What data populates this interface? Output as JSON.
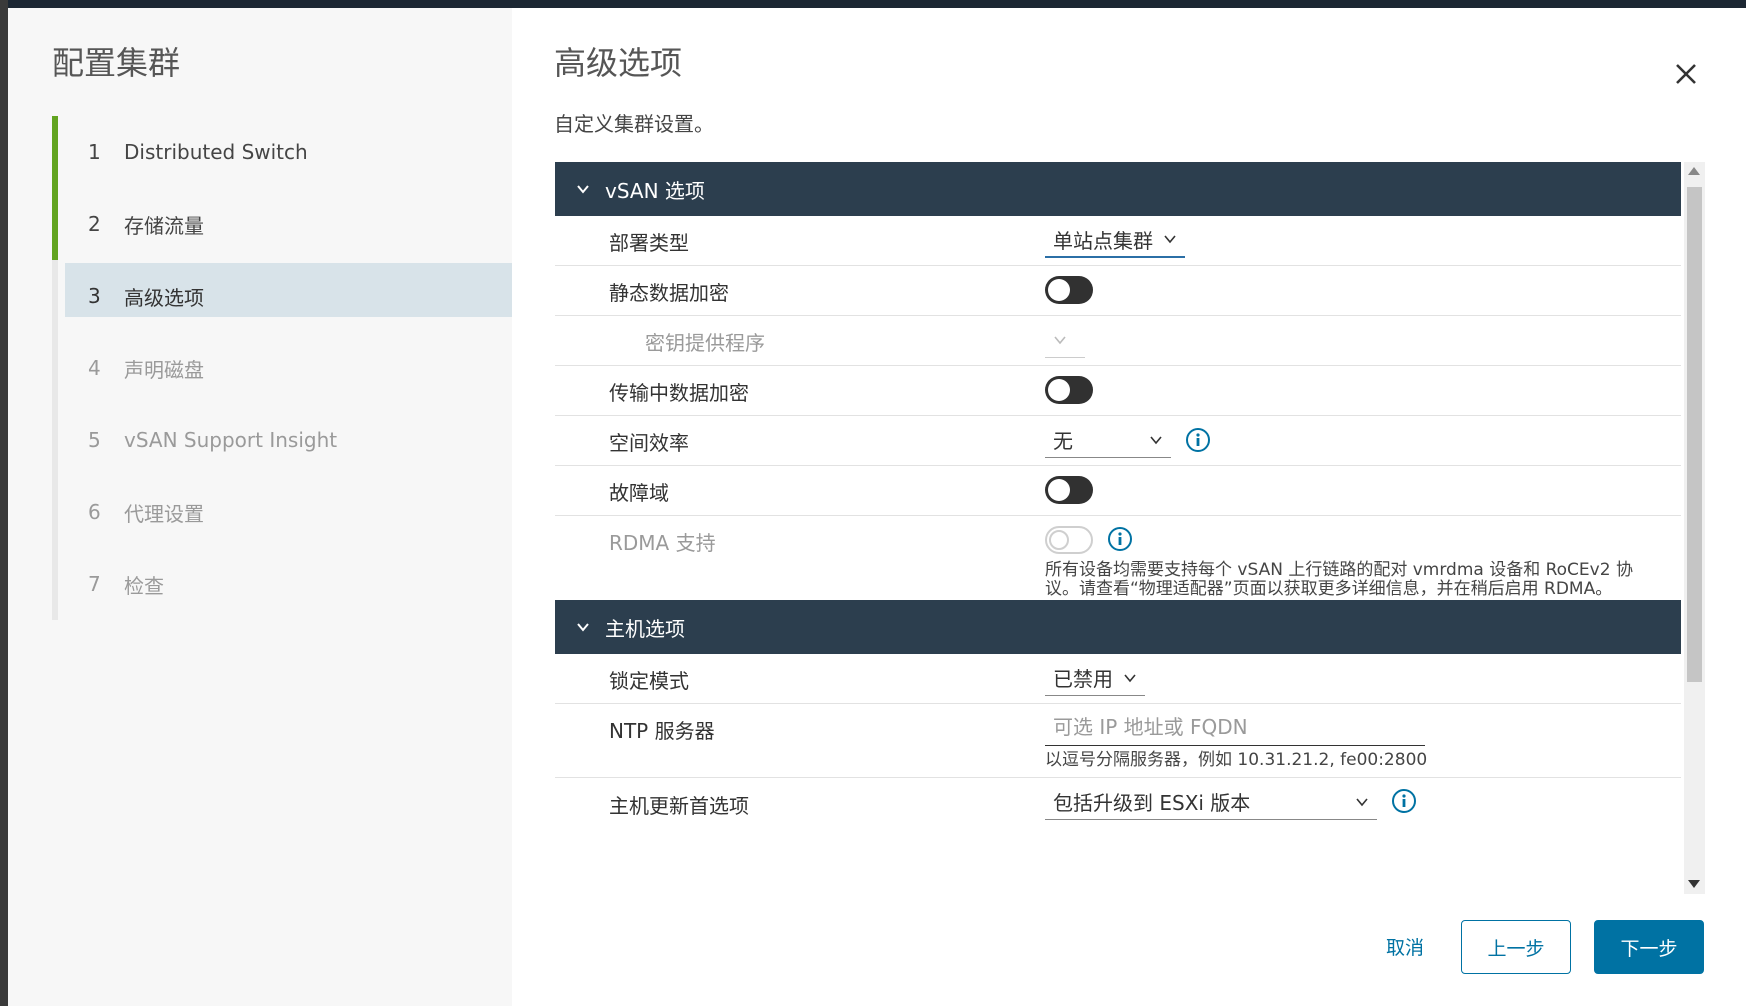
{
  "wizard": {
    "title": "配置集群",
    "steps": [
      {
        "num": "1",
        "label": "Distributed Switch"
      },
      {
        "num": "2",
        "label": "存储流量"
      },
      {
        "num": "3",
        "label": "高级选项"
      },
      {
        "num": "4",
        "label": "声明磁盘"
      },
      {
        "num": "5",
        "label": "vSAN Support Insight"
      },
      {
        "num": "6",
        "label": "代理设置"
      },
      {
        "num": "7",
        "label": "检查"
      }
    ]
  },
  "page": {
    "title": "高级选项",
    "subtitle": "自定义集群设置。"
  },
  "vsan": {
    "header": "vSAN 选项",
    "deployment_type": {
      "label": "部署类型",
      "value": "单站点集群"
    },
    "data_at_rest_encryption": {
      "label": "静态数据加密",
      "enabled": false
    },
    "kms_provider": {
      "label": "密钥提供程序",
      "value": ""
    },
    "data_in_transit_encryption": {
      "label": "传输中数据加密",
      "enabled": false
    },
    "space_efficiency": {
      "label": "空间效率",
      "value": "无"
    },
    "fault_domains": {
      "label": "故障域",
      "enabled": false
    },
    "rdma": {
      "label": "RDMA 支持",
      "enabled": false,
      "help_line1": "所有设备均需要支持每个 vSAN 上行链路的配对 vmrdma 设备和 RoCEv2 协",
      "help_line2": "议。请查看“物理适配器”页面以获取更多详细信息，并在稍后启用 RDMA。"
    }
  },
  "host": {
    "header": "主机选项",
    "lockdown_mode": {
      "label": "锁定模式",
      "value": "已禁用"
    },
    "ntp": {
      "label": "NTP 服务器",
      "placeholder": "可选 IP 地址或 FQDN",
      "value": "",
      "help": "以逗号分隔服务器，例如 10.31.21.2, fe00:2800"
    },
    "update_pref": {
      "label": "主机更新首选项",
      "value": "包括升级到 ESXi 版本"
    }
  },
  "footer": {
    "cancel": "取消",
    "back": "上一步",
    "next": "下一步"
  },
  "colors": {
    "section_header": "#2c3e4e",
    "primary": "#0072a3",
    "step_done": "#62a420",
    "step_active_bg": "#d8e3e9"
  }
}
